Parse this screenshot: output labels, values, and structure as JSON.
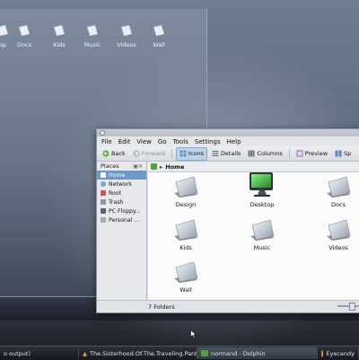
{
  "desktop": {
    "folder_labels": [
      "op",
      "Docs",
      "Kids",
      "Music",
      "Videos",
      "Wall"
    ]
  },
  "window": {
    "menu": [
      "File",
      "Edit",
      "View",
      "Go",
      "Tools",
      "Settings",
      "Help"
    ],
    "toolbar": {
      "back": "Back",
      "forward": "Forward",
      "icons": "Icons",
      "details": "Details",
      "columns": "Columns",
      "preview": "Preview",
      "split": "Sp"
    },
    "places": {
      "title": "Places",
      "items": [
        "Home",
        "Network",
        "Root",
        "Trash",
        "PC Floppy...",
        "Personal ..."
      ]
    },
    "breadcrumb": "Home",
    "files": [
      "Design",
      "Desktop",
      "Docs",
      "Kids",
      "Music",
      "Videos",
      "Wall"
    ],
    "status": "7 Folders"
  },
  "taskbar": {
    "tasks": [
      "o output)",
      "The.Sisterhood.Of.The.Traveling.Pant",
      "normand - Dolphin",
      "Eyecandy"
    ]
  },
  "colors": {
    "selection": "#6d99c8",
    "folder": "#c8d0d8",
    "desktop_folder": "#e8edf3"
  }
}
